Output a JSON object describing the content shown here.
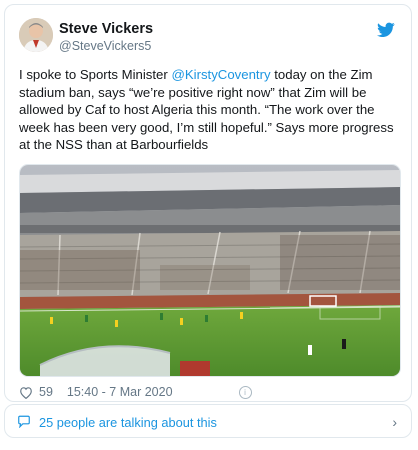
{
  "tweet": {
    "author_name": "Steve Vickers",
    "author_handle": "@SteveVickers5",
    "text_part1": "I spoke to Sports Minister ",
    "mention": "@KirstyCoventry",
    "text_part2": " today on the Zim stadium ban, says “we’re positive right now” that Zim will be allowed by Caf to host Algeria this month. “The work over the week has been very good, I’m still hopeful.” Says more progress at the NSS than at Barbourfields",
    "likes": "59",
    "timestamp": "15:40 - 7 Mar 2020"
  },
  "conversation": {
    "label": "25 people are talking about this"
  },
  "colors": {
    "accent": "#1b95e0",
    "text": "#14171a",
    "muted": "#657786",
    "border": "#e1e8ed"
  },
  "icons": [
    "twitter-bird-icon",
    "heart-icon",
    "info-icon",
    "speech-bubble-icon",
    "chevron-right-icon"
  ]
}
